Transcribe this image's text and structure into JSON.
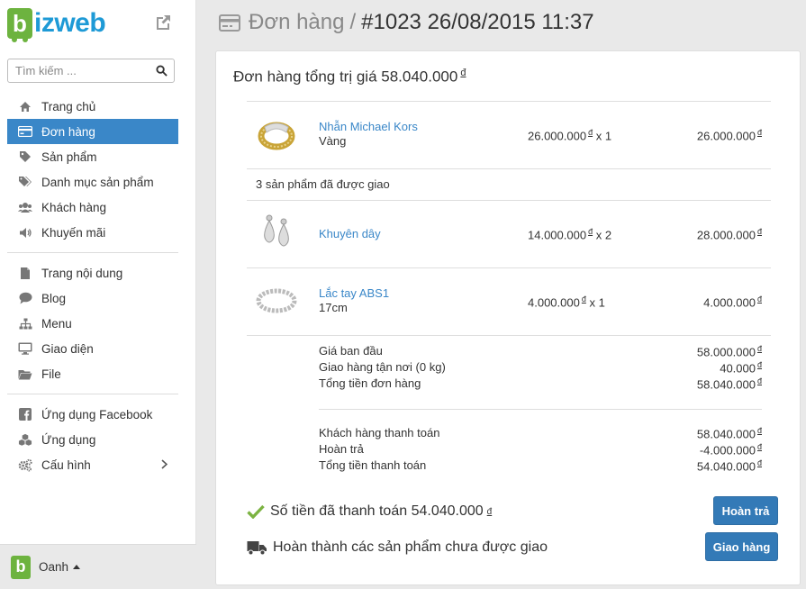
{
  "brand": {
    "logo_letter": "b",
    "logo_text": "izweb"
  },
  "search": {
    "placeholder": "Tìm kiếm ..."
  },
  "sidebar": {
    "group1": [
      {
        "label": "Trang chủ",
        "icon": "home-icon"
      },
      {
        "label": "Đơn hàng",
        "icon": "credit-card-icon",
        "active": true
      },
      {
        "label": "Sản phẩm",
        "icon": "tag-icon"
      },
      {
        "label": "Danh mục sản phẩm",
        "icon": "tags-icon"
      },
      {
        "label": "Khách hàng",
        "icon": "users-icon"
      },
      {
        "label": "Khuyến mãi",
        "icon": "megaphone-icon"
      }
    ],
    "group2": [
      {
        "label": "Trang nội dung",
        "icon": "file-icon"
      },
      {
        "label": "Blog",
        "icon": "comment-icon"
      },
      {
        "label": "Menu",
        "icon": "sitemap-icon"
      },
      {
        "label": "Giao diện",
        "icon": "monitor-icon"
      },
      {
        "label": "File",
        "icon": "folder-icon"
      }
    ],
    "group3": [
      {
        "label": "Ứng dụng Facebook",
        "icon": "facebook-icon"
      },
      {
        "label": "Ứng dụng",
        "icon": "cubes-icon"
      },
      {
        "label": "Cấu hình",
        "icon": "gears-icon"
      }
    ]
  },
  "user": {
    "avatar_letter": "b",
    "name": "Oanh"
  },
  "header": {
    "crumb": "Đơn hàng",
    "separator": "/",
    "title": "#1023 26/08/2015 11:37"
  },
  "order": {
    "heading": "Đơn hàng tổng trị giá 58.040.000",
    "currency": "đ",
    "products": [
      {
        "name": "Nhẫn Michael Kors",
        "variant": "Vàng",
        "price": "26.000.000",
        "qty": "x 1",
        "total": "26.000.000"
      },
      {
        "name": "Khuyên dây",
        "variant": "",
        "price": "14.000.000",
        "qty": "x 2",
        "total": "28.000.000"
      },
      {
        "name": "Lắc tay ABS1",
        "variant": "17cm",
        "price": "4.000.000",
        "qty": "x 1",
        "total": "4.000.000"
      }
    ],
    "shipped_note": "3 sản phẩm đã được giao",
    "summary1": [
      {
        "label": "Giá ban đầu",
        "value": "58.000.000"
      },
      {
        "label": "Giao hàng tận nơi (0 kg)",
        "value": "40.000"
      },
      {
        "label": "Tổng tiền đơn hàng",
        "value": "58.040.000"
      }
    ],
    "summary2": [
      {
        "label": "Khách hàng thanh toán",
        "value": "58.040.000"
      },
      {
        "label": "Hoàn trả",
        "value": "-4.000.000"
      },
      {
        "label": "Tổng tiền thanh toán",
        "value": "54.040.000"
      }
    ],
    "paid_status": "Số tiền đã thanh toán 54.040.000",
    "fulfill_status": "Hoàn thành các sản phẩm chưa được giao",
    "refund_button": "Hoàn trả",
    "ship_button": "Giao hàng"
  },
  "colors": {
    "accent": "#3a87c8",
    "brand_green": "#6db33f",
    "brand_blue": "#1e9ad6",
    "check_green": "#7cb342"
  }
}
